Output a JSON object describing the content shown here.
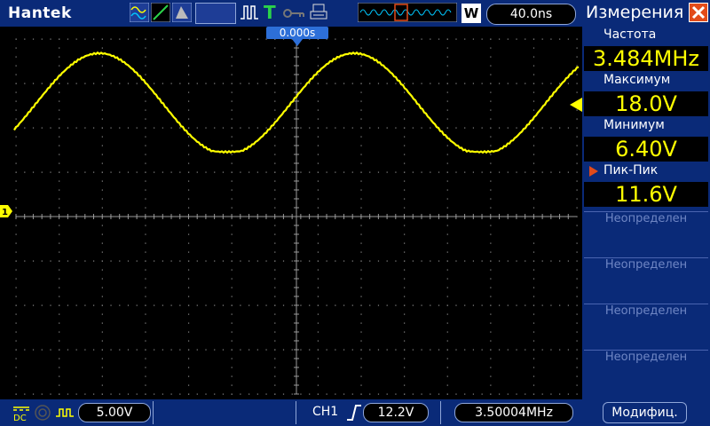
{
  "brand": "Hantek",
  "topbar": {
    "wave_mode_icons": [
      "wave-icon",
      "line-icon",
      "persist-icon"
    ],
    "trigger_icons": [
      "pulse-icon",
      "trigger-t-icon",
      "key-icon",
      "printer-icon"
    ],
    "w_label": "W",
    "timebase": "40.0ns"
  },
  "trigger": {
    "position_label": "0.000s"
  },
  "channel_marker": "1",
  "bottom": {
    "ch_scale": "5.00V",
    "trigger_channel": "CH1",
    "trigger_level": "12.2V",
    "trigger_freq": "3.50004MHz"
  },
  "panel": {
    "title": "Измерения",
    "measurements": [
      {
        "label": "Частота",
        "value": "3.484MHz"
      },
      {
        "label": "Максимум",
        "value": "18.0V"
      },
      {
        "label": "Минимум",
        "value": "6.40V"
      },
      {
        "label": "Пик-Пик",
        "value": "11.6V",
        "selected": true
      }
    ],
    "empty_slots": [
      "Неопределен",
      "Неопределен",
      "Неопределен",
      "Неопределен"
    ],
    "modify_label": "Модифиц."
  },
  "colors": {
    "trace": "#ffff00",
    "bar": "#0a2a78",
    "accent": "#e24b1a"
  }
}
